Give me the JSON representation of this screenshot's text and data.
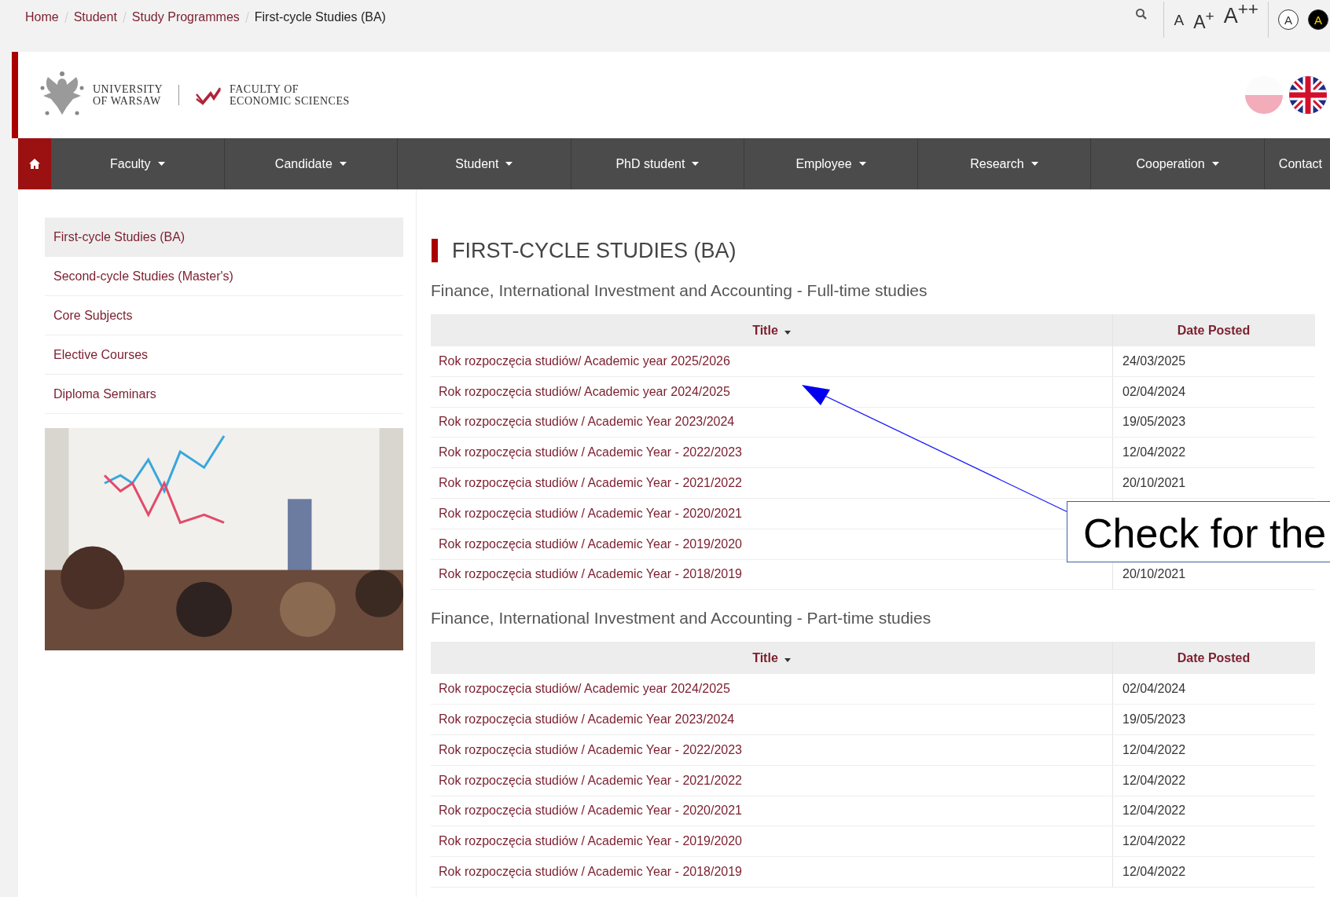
{
  "breadcrumbs": [
    {
      "label": "Home",
      "current": false
    },
    {
      "label": "Student",
      "current": false
    },
    {
      "label": "Study Programmes",
      "current": false
    },
    {
      "label": "First-cycle Studies (BA)",
      "current": true
    }
  ],
  "font_size_buttons": [
    "A",
    "A$^{+}$",
    "A$^{++}$"
  ],
  "contrast_buttons": [
    {
      "label": "A",
      "kind": "normal"
    },
    {
      "label": "A",
      "kind": "high"
    }
  ],
  "logo": {
    "university": [
      "UNIVERSITY",
      "OF WARSAW"
    ],
    "faculty": [
      "FACULTY OF",
      "ECONOMIC SCIENCES"
    ]
  },
  "languages": [
    {
      "kind": "pl",
      "selected": false
    },
    {
      "kind": "en",
      "selected": true
    }
  ],
  "nav": [
    {
      "label": "Faculty",
      "dropdown": true
    },
    {
      "label": "Candidate",
      "dropdown": true
    },
    {
      "label": "Student",
      "dropdown": true
    },
    {
      "label": "PhD student",
      "dropdown": true
    },
    {
      "label": "Employee",
      "dropdown": true
    },
    {
      "label": "Research",
      "dropdown": true
    },
    {
      "label": "Cooperation",
      "dropdown": true
    },
    {
      "label": "Contact",
      "dropdown": false
    }
  ],
  "sidebar": {
    "items": [
      {
        "label": "First-cycle Studies (BA)",
        "selected": true
      },
      {
        "label": "Second-cycle Studies (Master's)",
        "selected": false
      },
      {
        "label": "Core Subjects",
        "selected": false
      },
      {
        "label": "Elective Courses",
        "selected": false
      },
      {
        "label": "Diploma Seminars",
        "selected": false
      }
    ]
  },
  "heading": "FIRST-CYCLE STUDIES (BA)",
  "sections": [
    {
      "title": "Finance, International Investment and Accounting - Full-time studies",
      "columns": [
        "Title",
        "Date Posted"
      ],
      "rows": [
        {
          "title": "Rok rozpoczęcia studiów/ Academic year 2025/2026",
          "date": "24/03/2025"
        },
        {
          "title": "Rok rozpoczęcia studiów/ Academic year 2024/2025",
          "date": "02/04/2024"
        },
        {
          "title": "Rok rozpoczęcia studiów / Academic Year 2023/2024",
          "date": "19/05/2023"
        },
        {
          "title": "Rok rozpoczęcia studiów / Academic Year - 2022/2023",
          "date": "12/04/2022"
        },
        {
          "title": "Rok rozpoczęcia studiów / Academic Year - 2021/2022",
          "date": "20/10/2021"
        },
        {
          "title": "Rok rozpoczęcia studiów / Academic Year - 2020/2021"
        },
        {
          "title": "Rok rozpoczęcia studiów / Academic Year - 2019/2020"
        },
        {
          "title": "Rok rozpoczęcia studiów / Academic Year - 2018/2019",
          "date": "20/10/2021"
        }
      ]
    },
    {
      "title": "Finance, International Investment and Accounting - Part-time studies",
      "columns": [
        "Title",
        "Date Posted"
      ],
      "rows": [
        {
          "title": "Rok rozpoczęcia studiów/ Academic year 2024/2025",
          "date": "02/04/2024"
        },
        {
          "title": "Rok rozpoczęcia studiów / Academic Year 2023/2024",
          "date": "19/05/2023"
        },
        {
          "title": "Rok rozpoczęcia studiów / Academic Year - 2022/2023",
          "date": "12/04/2022"
        },
        {
          "title": "Rok rozpoczęcia studiów / Academic Year - 2021/2022",
          "date": "12/04/2022"
        },
        {
          "title": "Rok rozpoczęcia studiów / Academic Year - 2020/2021",
          "date": "12/04/2022"
        },
        {
          "title": "Rok rozpoczęcia studiów / Academic Year - 2019/2020",
          "date": "12/04/2022"
        },
        {
          "title": "Rok rozpoczęcia studiów / Academic Year - 2018/2019",
          "date": "12/04/2022"
        }
      ]
    }
  ],
  "callout": {
    "text": "Check for the"
  }
}
